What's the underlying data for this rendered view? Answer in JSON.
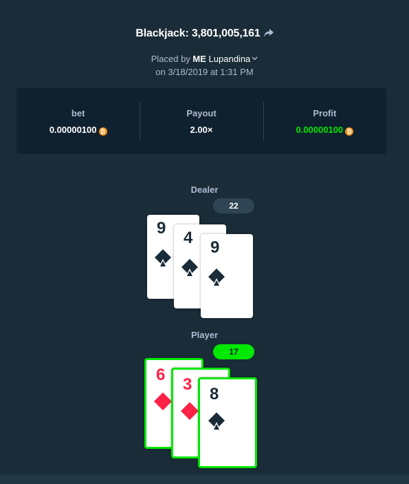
{
  "header": {
    "title": "Blackjack: 3,801,005,161",
    "placed_prefix": "Placed by ",
    "user_badge": "ME",
    "user_name": "Lupandina",
    "date": "on 3/18/2019 at 1:31 PM"
  },
  "stats": {
    "bet_label": "bet",
    "bet_value": "0.00000100",
    "payout_label": "Payout",
    "payout_value": "2.00×",
    "profit_label": "Profit",
    "profit_value": "0.00000100",
    "currency_symbol": "₿"
  },
  "dealer": {
    "label": "Dealer",
    "score": "22",
    "cards": [
      {
        "rank": "9",
        "suit": "spade"
      },
      {
        "rank": "4",
        "suit": "spade"
      },
      {
        "rank": "9",
        "suit": "spade"
      }
    ]
  },
  "player": {
    "label": "Player",
    "score": "17",
    "cards": [
      {
        "rank": "6",
        "suit": "diamond"
      },
      {
        "rank": "3",
        "suit": "diamond"
      },
      {
        "rank": "8",
        "suit": "spade"
      }
    ]
  },
  "colors": {
    "background": "#1a2c38",
    "panel": "#0f212e",
    "win_green": "#00e701",
    "red_suit": "#fe2247",
    "black_suit": "#1a2c38",
    "coin": "#f7931a"
  },
  "icons": {
    "share": "share-arrow-icon",
    "chevron": "chevron-down-icon",
    "currency": "bitcoin-icon",
    "spade": "spade-icon",
    "diamond": "diamond-icon"
  }
}
